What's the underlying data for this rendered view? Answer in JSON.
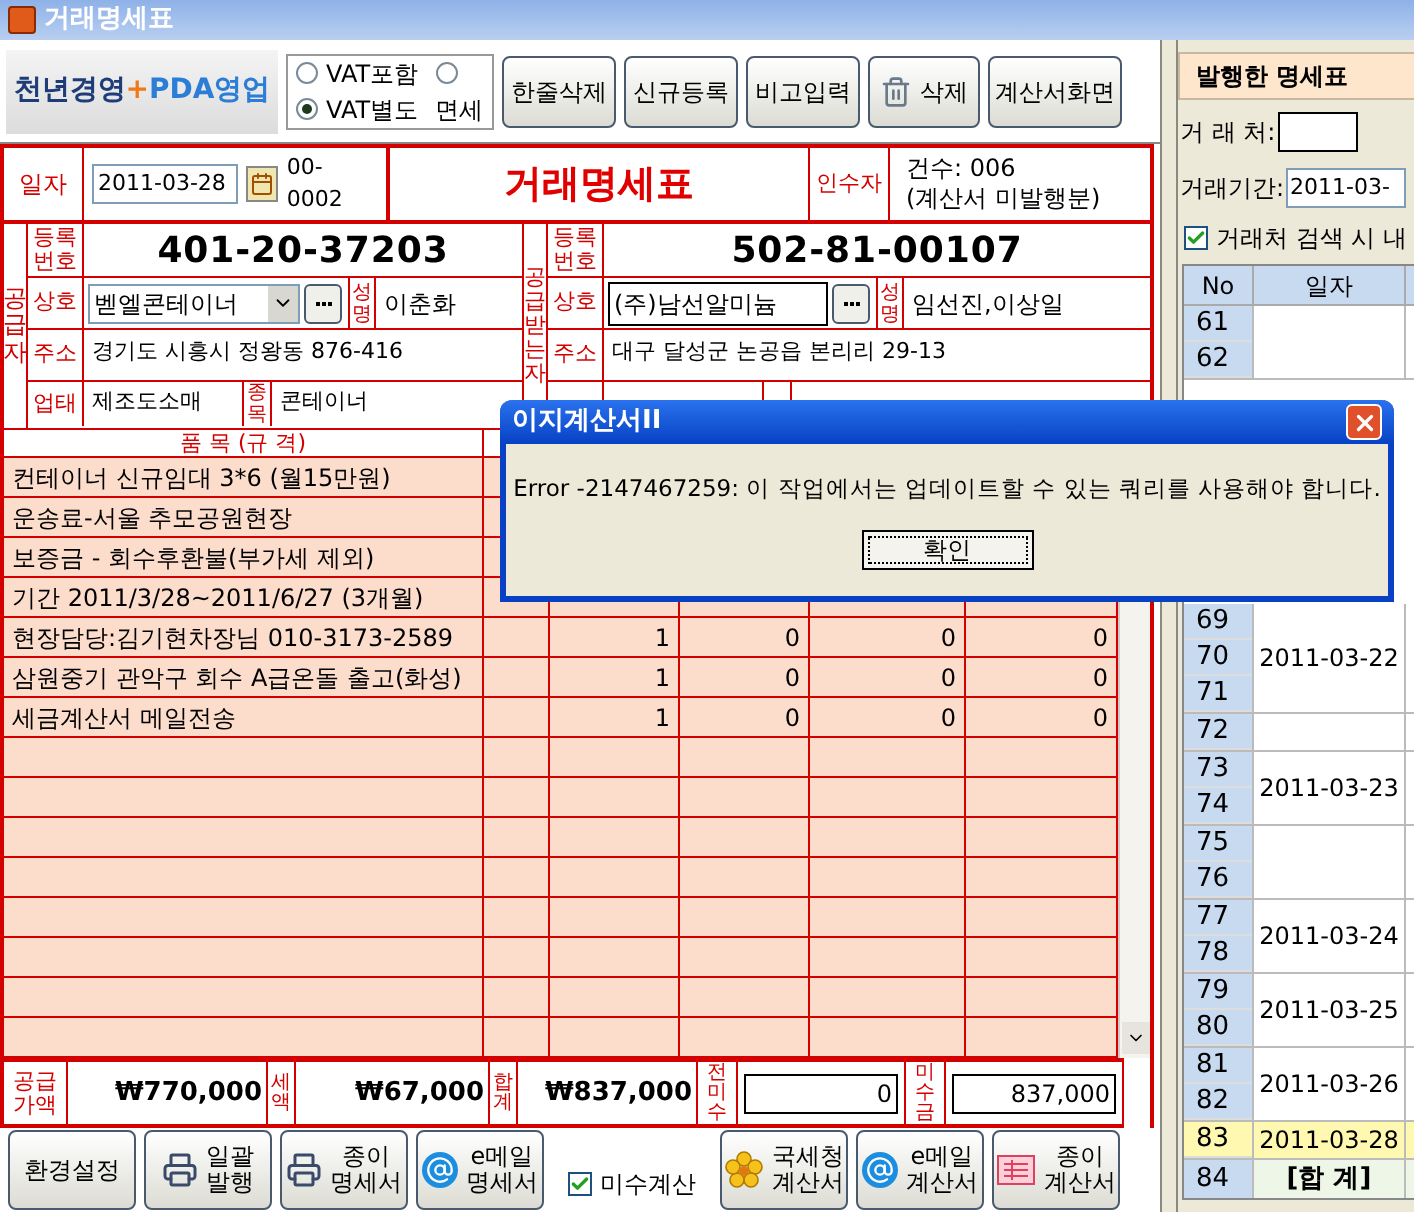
{
  "window": {
    "title": "거래명세표"
  },
  "logo": {
    "parts": [
      {
        "text": "천년경영",
        "color": "#1e3d78"
      },
      {
        "text": "+",
        "color": "#f07a1a"
      },
      {
        "text": "PDA영업",
        "color": "#2b7dd6"
      }
    ]
  },
  "vat_options": [
    {
      "label": "VAT포함",
      "selected": false
    },
    {
      "label": "VAT별도",
      "selected": true
    },
    {
      "label": "면세",
      "selected": false
    }
  ],
  "toolbar": [
    {
      "label": "한줄삭제",
      "kind": "plain"
    },
    {
      "label": "신규등록",
      "kind": "plain"
    },
    {
      "label": "비고입력",
      "kind": "plain"
    },
    {
      "label": "삭제",
      "kind": "delete"
    },
    {
      "label": "계산서화면",
      "kind": "plain"
    }
  ],
  "invoice": {
    "date_label": "일자",
    "date": "2011-03-28",
    "number": "00-0002",
    "title": "거래명세표",
    "receiver_label": "인수자",
    "count": "건수: 006",
    "count_note": "(계산서 미발행분)"
  },
  "supplier": {
    "side_label": "공급자",
    "reg_label": "등록번호",
    "reg_no": "401-20-37203",
    "name_label": "상호",
    "name": "벧엘콘테이너",
    "rep_label": "성명",
    "rep": "이춘화",
    "addr_label": "주소",
    "addr": "경기도 시흥시 정왕동 876-416",
    "type_label": "업태",
    "type": "제조도소매",
    "item_label": "종목",
    "item": "콘테이너"
  },
  "buyer": {
    "side_label": "공급받는자",
    "reg_label": "등록번호",
    "reg_no": "502-81-00107",
    "name_label": "상호",
    "name": "(주)남선알미늄",
    "rep_label": "성명",
    "rep": "임선진,이상일",
    "addr_label": "주소",
    "addr": "대구 달성군 논공읍 본리리 29-13"
  },
  "items": {
    "header": "품 목 (규 격)",
    "rows": [
      {
        "name": "컨테이너 신규임대 3*6 (월15만원)"
      },
      {
        "name": "운송료-서울 추모공원현장"
      },
      {
        "name": "보증금 - 회수후환불(부가세 제외)"
      },
      {
        "name": "기간 2011/3/28~2011/6/27 (3개월)"
      },
      {
        "name": "현장담당:김기현차장님 010-3173-2589",
        "values": [
          "1",
          "0",
          "0",
          "0"
        ]
      },
      {
        "name": "삼원중기 관악구 회수 A급온돌 출고(화성)",
        "values": [
          "1",
          "0",
          "0",
          "0"
        ]
      },
      {
        "name": "세금계산서 메일전송",
        "values": [
          "1",
          "0",
          "0",
          "0"
        ]
      }
    ]
  },
  "totals": [
    {
      "label": "공급가액",
      "value": "₩770,000",
      "kind": "amount"
    },
    {
      "label": "세액",
      "value": "₩67,000",
      "kind": "amount"
    },
    {
      "label": "합계",
      "value": "₩837,000",
      "kind": "amount"
    },
    {
      "label": "전미수",
      "value": "0",
      "kind": "field"
    },
    {
      "label": "미수금",
      "value": "837,000",
      "kind": "field"
    }
  ],
  "bottom": [
    {
      "kind": "plain",
      "lines": [
        "환경설정"
      ]
    },
    {
      "kind": "printer",
      "lines": [
        "일괄",
        "발행"
      ]
    },
    {
      "kind": "printer",
      "lines": [
        "종이",
        "명세서"
      ]
    },
    {
      "kind": "email",
      "lines": [
        "e메일",
        "명세서"
      ]
    },
    {
      "kind": "checkbox",
      "lines": [
        "미수계산"
      ],
      "checked": true
    },
    {
      "kind": "flower",
      "lines": [
        "국세청",
        "계산서"
      ]
    },
    {
      "kind": "email",
      "lines": [
        "e메일",
        "계산서"
      ]
    },
    {
      "kind": "paper",
      "lines": [
        "종이",
        "계산서"
      ]
    }
  ],
  "issued": {
    "title": "발행한 명세표",
    "partner_label": "거 래 처:",
    "period_label": "거래기간:",
    "period_from": "2011-03-",
    "search_option": {
      "label": "거래처 검색 시 내",
      "checked": true
    },
    "columns": [
      "No",
      "일자"
    ],
    "groups": [
      {
        "rows": [
          {
            "no": "61",
            "selected": false
          },
          {
            "no": "62",
            "selected": false
          }
        ]
      },
      {
        "date": "2011-03-22",
        "rows": [
          {
            "no": "69",
            "selected": false
          },
          {
            "no": "70",
            "selected": false
          },
          {
            "no": "71",
            "selected": false
          }
        ]
      },
      {
        "rows": [
          {
            "no": "72",
            "selected": false
          }
        ]
      },
      {
        "date": "2011-03-23",
        "rows": [
          {
            "no": "73",
            "selected": false
          },
          {
            "no": "74",
            "selected": false
          }
        ]
      },
      {
        "rows": [
          {
            "no": "75",
            "selected": false
          },
          {
            "no": "76",
            "selected": false
          }
        ]
      },
      {
        "date": "2011-03-24",
        "rows": [
          {
            "no": "77",
            "selected": false
          },
          {
            "no": "78",
            "selected": false
          }
        ]
      },
      {
        "date": "2011-03-25",
        "rows": [
          {
            "no": "79",
            "selected": false
          },
          {
            "no": "80",
            "selected": false
          }
        ]
      },
      {
        "date": "2011-03-26",
        "rows": [
          {
            "no": "81",
            "selected": false
          },
          {
            "no": "82",
            "selected": false
          }
        ]
      },
      {
        "date": "2011-03-28",
        "rows": [
          {
            "no": "83",
            "selected": true
          }
        ]
      }
    ],
    "total_row": {
      "no": "84",
      "label": "[합 계]"
    }
  },
  "dialog": {
    "title": "이지계산서II",
    "message": "Error -2147467259: 이 작업에서는 업데이트할 수 있는 쿼리를 사용해야 합니다.",
    "button": "확인"
  }
}
